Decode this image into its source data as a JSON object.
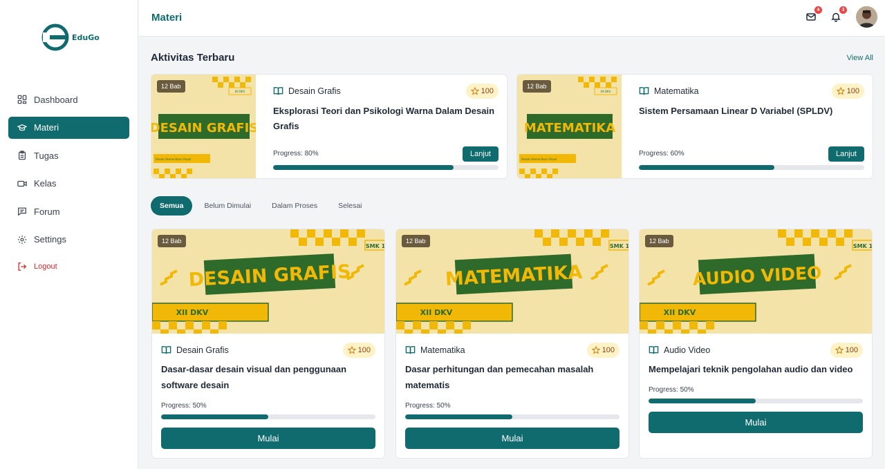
{
  "app": {
    "logo_text": "EduGo",
    "page_title": "Materi"
  },
  "sidebar": {
    "items": [
      {
        "label": "Dashboard",
        "icon": "dashboard-icon"
      },
      {
        "label": "Materi",
        "icon": "graduation-cap-icon",
        "active": true
      },
      {
        "label": "Tugas",
        "icon": "clipboard-icon"
      },
      {
        "label": "Kelas",
        "icon": "video-icon"
      },
      {
        "label": "Forum",
        "icon": "message-icon"
      },
      {
        "label": "Settings",
        "icon": "gear-icon"
      }
    ],
    "logout_label": "Logout"
  },
  "header": {
    "mail_count": "4",
    "notif_count": "3"
  },
  "recent": {
    "title": "Aktivitas Terbaru",
    "view_all": "View All",
    "cards": [
      {
        "bab": "12 Bab",
        "subject": "Desain Grafis",
        "points": "100",
        "title": "Eksplorasi Teori dan Psikologi Warna Dalam Desain Grafis",
        "progress_label": "Progress: 80%",
        "progress": 0.8,
        "button": "Lanjut",
        "thumb_title": "DESAIN GRAFIS",
        "thumb_tag": "XII DKV",
        "thumb_sub": "Desain Komunikasi Visual"
      },
      {
        "bab": "12 Bab",
        "subject": "Matematika",
        "points": "100",
        "title": "Sistem Persamaan Linear D Variabel (SPLDV)",
        "progress_label": "Progress: 60%",
        "progress": 0.6,
        "button": "Lanjut",
        "thumb_title": "MATEMATIKA",
        "thumb_tag": "XII DKV",
        "thumb_sub": "Desain Komunikasi Visual"
      }
    ]
  },
  "tabs": [
    "Semua",
    "Belum Dimulai",
    "Dalam Proses",
    "Selesai"
  ],
  "courses": [
    {
      "bab": "12 Bab",
      "corner": "SMK 1",
      "thumb_title": "DESAIN GRAFIS",
      "thumb_tag": "XII DKV",
      "subject": "Desain Grafis",
      "points": "100",
      "title": "Dasar-dasar desain visual dan penggunaan software desain",
      "progress_label": "Progress: 50%",
      "progress": 0.5,
      "button": "Mulai"
    },
    {
      "bab": "12 Bab",
      "corner": "SMK 1",
      "thumb_title": "MATEMATIKA",
      "thumb_tag": "XII DKV",
      "subject": "Matematika",
      "points": "100",
      "title": "Dasar perhitungan dan pemecahan masalah matematis",
      "progress_label": "Progress: 50%",
      "progress": 0.5,
      "button": "Mulai"
    },
    {
      "bab": "12 Bab",
      "corner": "SMK 1",
      "thumb_title": "AUDIO VIDEO",
      "thumb_tag": "XII DKV",
      "subject": "Audio Video",
      "points": "100",
      "title": "Mempelajari teknik pengolahan audio dan video",
      "progress_label": "Progress: 50%",
      "progress": 0.5,
      "button": "Mulai"
    }
  ],
  "colors": {
    "primary": "#0f6b6e",
    "thumb_bg": "#f3e3a8",
    "thumb_accent": "#f2b807",
    "thumb_green": "#2e6b2b"
  }
}
